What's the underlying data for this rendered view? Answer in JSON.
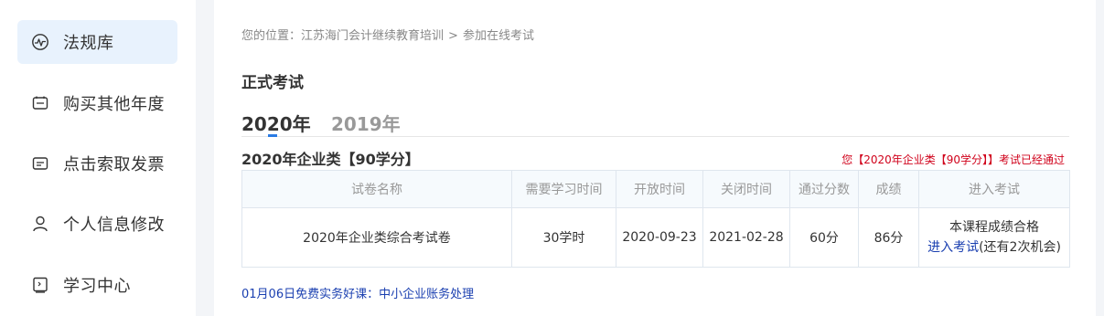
{
  "sidebar": {
    "items": [
      {
        "label": "法规库",
        "icon": "pulse-icon",
        "active": true
      },
      {
        "label": "购买其他年度",
        "icon": "cart-icon"
      },
      {
        "label": "点击索取发票",
        "icon": "invoice-icon"
      },
      {
        "label": "个人信息修改",
        "icon": "user-icon"
      },
      {
        "label": "学习中心",
        "icon": "study-icon"
      }
    ]
  },
  "breadcrumb": {
    "prefix": "您的位置：",
    "home": "江苏海门会计继续教育培训",
    "separator": ">",
    "current": "参加在线考试"
  },
  "section_title": "正式考试",
  "tabs": [
    {
      "label": "2020年",
      "active": true
    },
    {
      "label": "2019年",
      "active": false
    }
  ],
  "exam": {
    "title": "2020年企业类【90学分】",
    "pass_notice": "您【2020年企业类【90学分】】考试已经通过",
    "headers": [
      "试卷名称",
      "需要学习时间",
      "开放时间",
      "关闭时间",
      "通过分数",
      "成绩",
      "进入考试"
    ],
    "row": {
      "name": "2020年企业类综合考试卷",
      "study_time": "30学时",
      "open_date": "2020-09-23",
      "close_date": "2021-02-28",
      "pass_score": "60分",
      "score": "86分",
      "status": "本课程成绩合格",
      "enter_link": "进入考试",
      "chances": "(还有2次机会)"
    }
  },
  "promo_link": "01月06日免费实务好课：中小企业账务处理",
  "colors": {
    "accent": "#2a7be4",
    "active_bg": "#e8f2fd",
    "notice": "#d0021b",
    "link": "#1a3fb0"
  }
}
